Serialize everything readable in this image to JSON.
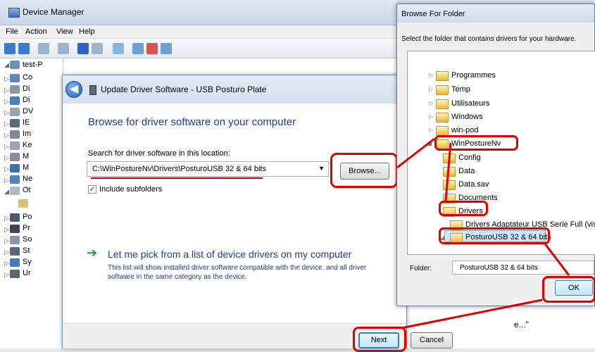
{
  "device_manager": {
    "title": "Device Manager",
    "menu": [
      "File",
      "Action",
      "View",
      "Help"
    ],
    "tree_root": "test-P",
    "tree_items": [
      "Co",
      "Di",
      "Di",
      "DV",
      "IE",
      "Im",
      "Ke",
      "M",
      "M",
      "Ne",
      "Ot",
      "Po",
      "Pr",
      "So",
      "St",
      "Sy",
      "Ur"
    ],
    "bg_text": "e...\""
  },
  "wizard": {
    "title": "Update Driver Software - USB Posturo Plate",
    "heading": "Browse for driver software on your computer",
    "search_label": "Search for driver software in this location:",
    "path_value": "C:\\WinPostureNv\\Drivers\\PosturoUSB 32 & 64 bits",
    "browse_label": "Browse...",
    "include_subfolders_label": "Include subfolders",
    "include_subfolders_checked": true,
    "pick_title": "Let me pick from a list of device drivers on my computer",
    "pick_desc_line1": "This list will show installed driver software compatible with the device, and all driver",
    "pick_desc_line2": "software in the same category as the device.",
    "next_label": "Next",
    "cancel_label": "Cancel"
  },
  "browse_folder": {
    "title": "Browse For Folder",
    "prompt": "Select the folder that contains drivers for your hardware.",
    "folders": [
      {
        "label": "Programmes",
        "depth": 0,
        "expander": "closed"
      },
      {
        "label": "Temp",
        "depth": 0,
        "expander": "closed"
      },
      {
        "label": "Utilisateurs",
        "depth": 0,
        "expander": "closed"
      },
      {
        "label": "Windows",
        "depth": 0,
        "expander": "closed"
      },
      {
        "label": "win-pod",
        "depth": 0,
        "expander": "closed"
      },
      {
        "label": "WinPostureNv",
        "depth": 0,
        "expander": "open"
      },
      {
        "label": "Config",
        "depth": 1,
        "expander": "none"
      },
      {
        "label": "Data",
        "depth": 1,
        "expander": "none"
      },
      {
        "label": "Data.sav",
        "depth": 1,
        "expander": "none"
      },
      {
        "label": "Documents",
        "depth": 1,
        "expander": "none"
      },
      {
        "label": "Drivers",
        "depth": 1,
        "expander": "open"
      },
      {
        "label": "Drivers Adaptateur USB Serie Full (vista",
        "depth": 2,
        "expander": "none"
      },
      {
        "label": "PosturoUSB 32 & 64 bits",
        "depth": 2,
        "expander": "open"
      }
    ],
    "folder_label": "Folder:",
    "folder_value": "PosturoUSB 32 & 64 bits",
    "ok_label": "OK"
  },
  "colors": {
    "highlight": "#e00000",
    "link_blue": "#1e3d8f",
    "selection": "#cce8ff"
  }
}
